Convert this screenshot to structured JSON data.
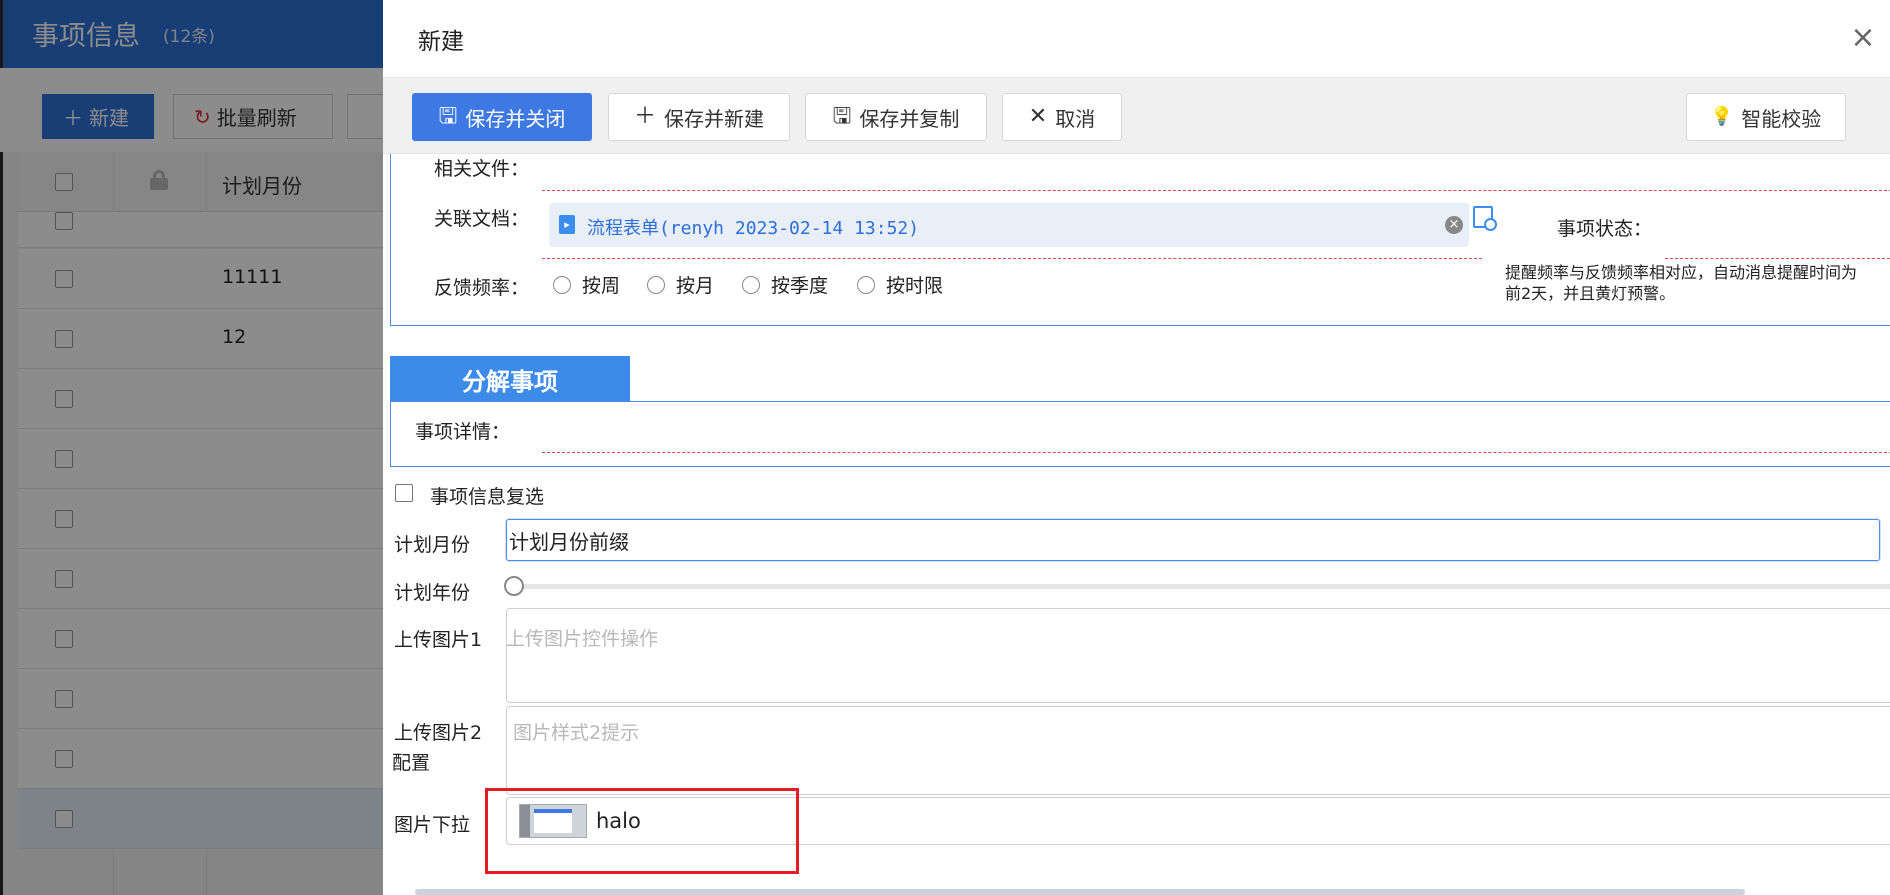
{
  "background_page": {
    "title": "事项信息",
    "count": "(12条)",
    "toolbar": {
      "new_label": "新建",
      "refresh_label": "批量刷新"
    },
    "table": {
      "header": "计划月份",
      "rows": [
        "",
        "11111",
        "12",
        "",
        "",
        "",
        "",
        "",
        "",
        "",
        ""
      ]
    }
  },
  "drawer": {
    "title": "新建",
    "toolbar": {
      "save_close": "保存并关闭",
      "save_new": "保存并新建",
      "save_copy": "保存并复制",
      "cancel": "取消",
      "smart_check": "智能校验"
    },
    "form": {
      "related_files_label": "相关文件：",
      "linked_docs_label": "关联文档：",
      "linked_doc_value": "流程表单(renyh 2023-02-14 13:52)",
      "status_label": "事项状态：",
      "feedback_label": "反馈频率：",
      "feedback_options": [
        "按周",
        "按月",
        "按季度",
        "按时限"
      ],
      "hint_line1": "提醒频率与反馈频率相对应，自动消息提醒时间为",
      "hint_line2": "前2天，并且黄灯预警。"
    },
    "section": {
      "tab": "分解事项",
      "detail_label": "事项详情："
    },
    "fields": {
      "multi_check_label": "事项信息复选",
      "plan_month_label": "计划月份",
      "plan_month_value": "计划月份前缀",
      "plan_year_label": "计划年份",
      "upload1_label": "上传图片1",
      "upload1_placeholder": "上传图片控件操作",
      "upload2_label_line1": "上传图片2",
      "upload2_label_line2": "配置",
      "upload2_placeholder": "图片样式2提示",
      "img_dropdown_label": "图片下拉",
      "img_dropdown_value": "halo"
    }
  }
}
